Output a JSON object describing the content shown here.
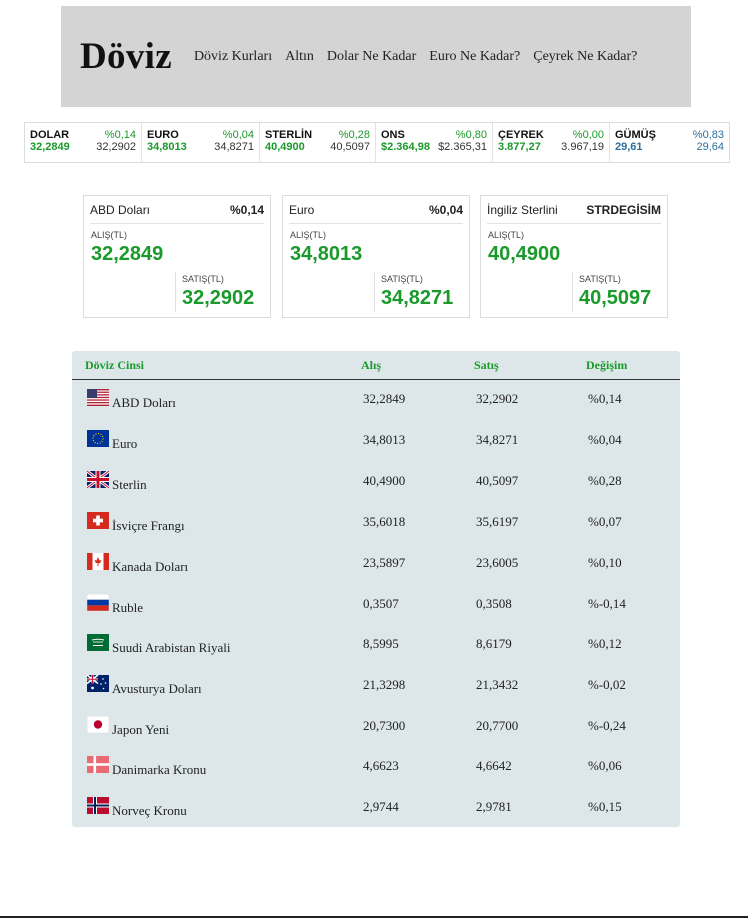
{
  "header": {
    "logo": "Döviz",
    "nav": [
      "Döviz Kurları",
      "Altın",
      "Dolar Ne Kadar",
      "Euro Ne Kadar?",
      "Çeyrek Ne Kadar?"
    ]
  },
  "ticker": [
    {
      "name": "DOLAR",
      "change": "%0,14",
      "buy": "32,2849",
      "sell": "32,2902"
    },
    {
      "name": "EURO",
      "change": "%0,04",
      "buy": "34,8013",
      "sell": "34,8271"
    },
    {
      "name": "STERLİN",
      "change": "%0,28",
      "buy": "40,4900",
      "sell": "40,5097"
    },
    {
      "name": "ONS",
      "change": "%0,80",
      "buy": "$2.364,98",
      "sell": "$2.365,31"
    },
    {
      "name": "ÇEYREK",
      "change": "%0,00",
      "buy": "3.877,27",
      "sell": "3.967,19"
    },
    {
      "name": "GÜMÜŞ",
      "change": "%0,83",
      "buy": "29,61",
      "sell": "29,64"
    }
  ],
  "cards": [
    {
      "name": "ABD Doları",
      "change": "%0,14",
      "buy_label": "ALIŞ(TL)",
      "buy": "32,2849",
      "sell_label": "SATIŞ(TL)",
      "sell": "32,2902"
    },
    {
      "name": "Euro",
      "change": "%0,04",
      "buy_label": "ALIŞ(TL)",
      "buy": "34,8013",
      "sell_label": "SATIŞ(TL)",
      "sell": "34,8271"
    },
    {
      "name": "İngiliz Sterlini",
      "change": "STRDEGİSİM",
      "buy_label": "ALIŞ(TL)",
      "buy": "40,4900",
      "sell_label": "SATIŞ(TL)",
      "sell": "40,5097"
    }
  ],
  "table": {
    "headers": [
      "Döviz Cinsi",
      "Alış",
      "Satış",
      "Değişim"
    ],
    "rows": [
      {
        "flag": "us-flag-icon",
        "name": "ABD Doları",
        "buy": "32,2849",
        "sell": "32,2902",
        "change": "%0,14"
      },
      {
        "flag": "eu-flag-icon",
        "name": "Euro",
        "buy": "34,8013",
        "sell": "34,8271",
        "change": "%0,04"
      },
      {
        "flag": "uk-flag-icon",
        "name": "Sterlin",
        "buy": "40,4900",
        "sell": "40,5097",
        "change": "%0,28"
      },
      {
        "flag": "ch-flag-icon",
        "name": "İsviçre Frangı",
        "buy": "35,6018",
        "sell": "35,6197",
        "change": "%0,07"
      },
      {
        "flag": "ca-flag-icon",
        "name": "Kanada Doları",
        "buy": "23,5897",
        "sell": "23,6005",
        "change": "%0,10"
      },
      {
        "flag": "ru-flag-icon",
        "name": "Ruble",
        "buy": "0,3507",
        "sell": "0,3508",
        "change": "%-0,14"
      },
      {
        "flag": "sa-flag-icon",
        "name": "Suudi Arabistan Riyali",
        "buy": "8,5995",
        "sell": "8,6179",
        "change": "%0,12"
      },
      {
        "flag": "au-flag-icon",
        "name": "Avusturya Doları",
        "buy": "21,3298",
        "sell": "21,3432",
        "change": "%-0,02"
      },
      {
        "flag": "jp-flag-icon",
        "name": "Japon Yeni",
        "buy": "20,7300",
        "sell": "20,7700",
        "change": "%-0,24"
      },
      {
        "flag": "dk-flag-icon",
        "name": "Danimarka Kronu",
        "buy": "4,6623",
        "sell": "4,6642",
        "change": "%0,06"
      },
      {
        "flag": "no-flag-icon",
        "name": "Norveç Kronu",
        "buy": "2,9744",
        "sell": "2,9781",
        "change": "%0,15"
      }
    ]
  },
  "colors": {
    "accent_green": "#1a9a2a",
    "silver_blue": "#2a6f9e",
    "header_bg": "#d4d4d4",
    "table_bg": "#dde7ea"
  }
}
